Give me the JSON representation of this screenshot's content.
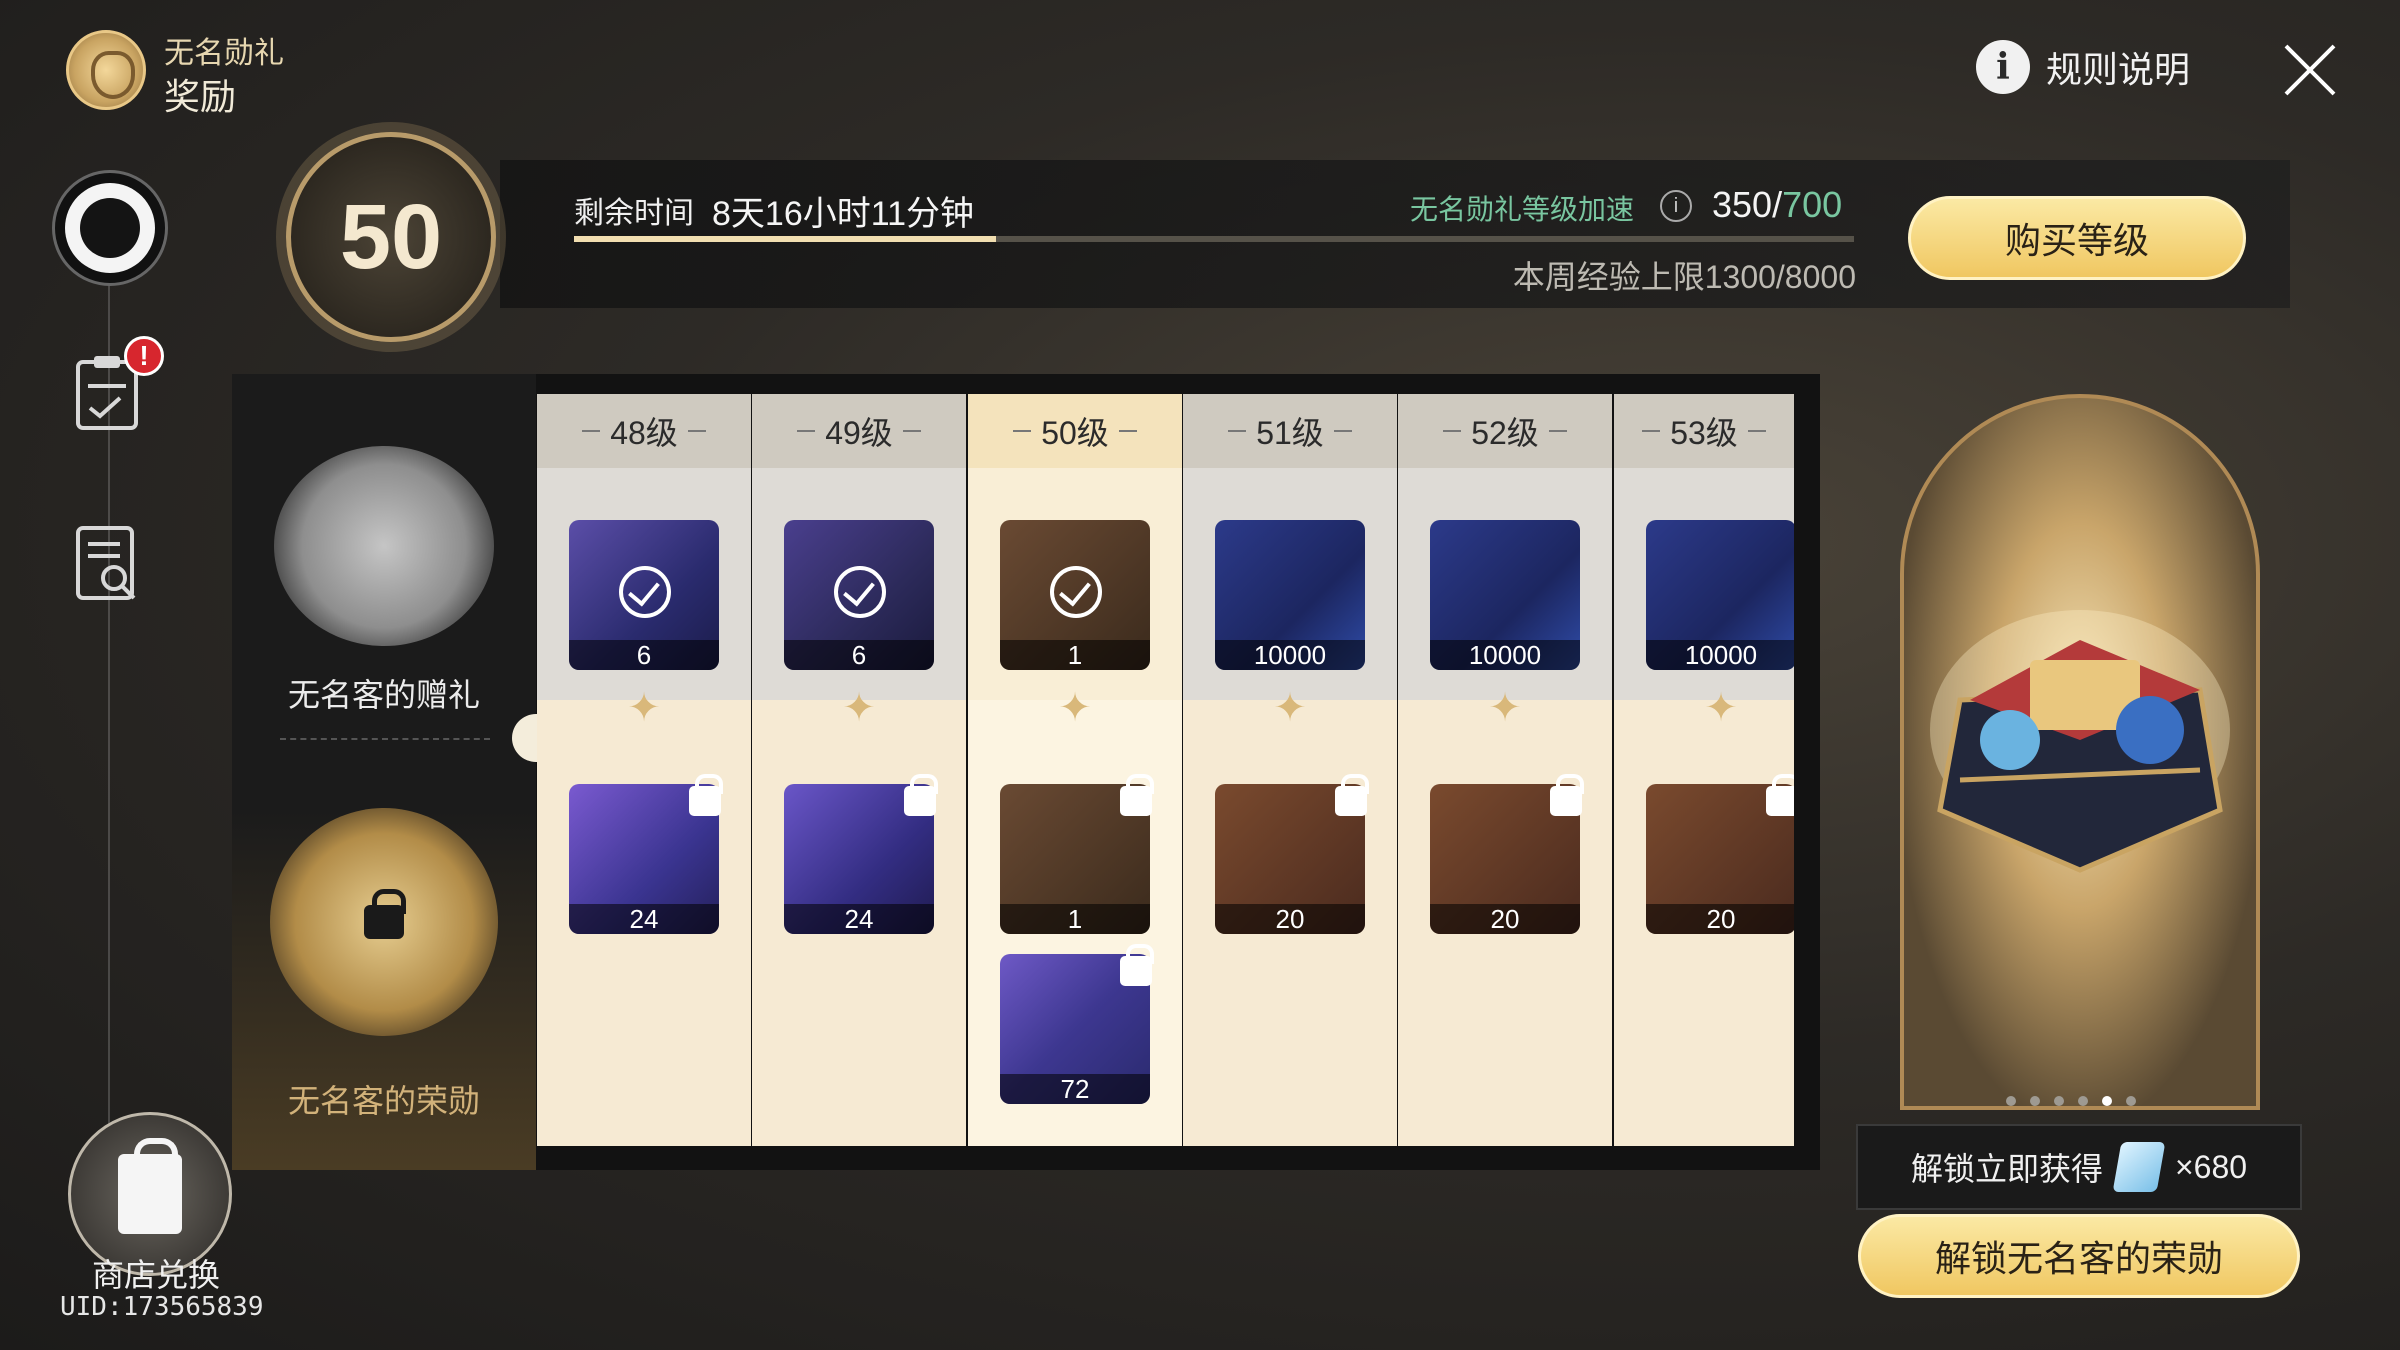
{
  "header": {
    "subtitle": "无名勋礼",
    "title": "奖励"
  },
  "rules": {
    "label": "规则说明",
    "icon": "info-icon"
  },
  "close": {
    "icon": "close-icon"
  },
  "sidebar": {
    "alert_count": "!",
    "shop_label": "商店兑换",
    "uid": "UID:173565839"
  },
  "level": {
    "current": "50"
  },
  "progress": {
    "time_label": "剩余时间",
    "time_value": "8天16小时11分钟",
    "fill_fraction": 0.33,
    "boost_label": "无名勋礼等级加速",
    "exp_current": "350/",
    "exp_max": "700",
    "week_cap": "本周经验上限1300/8000",
    "buy_button": "购买等级"
  },
  "tracks": {
    "free_label": "无名客的赠礼",
    "premium_label": "无名客的荣勋"
  },
  "levels": [
    {
      "label": "48级",
      "free": {
        "qty": "6",
        "claimed": true
      },
      "premium": [
        {
          "qty": "24"
        }
      ]
    },
    {
      "label": "49级",
      "free": {
        "qty": "6",
        "claimed": true
      },
      "premium": [
        {
          "qty": "24"
        }
      ]
    },
    {
      "label": "50级",
      "free": {
        "qty": "1",
        "claimed": true
      },
      "premium": [
        {
          "qty": "1"
        },
        {
          "qty": "72"
        }
      ]
    },
    {
      "label": "51级",
      "free": {
        "qty": "10000",
        "claimed": false
      },
      "premium": [
        {
          "qty": "20"
        }
      ]
    },
    {
      "label": "52级",
      "free": {
        "qty": "10000",
        "claimed": false
      },
      "premium": [
        {
          "qty": "20"
        }
      ]
    },
    {
      "label": "53级",
      "free": {
        "qty": "10000",
        "claimed": false
      },
      "premium": [
        {
          "qty": "20"
        }
      ]
    }
  ],
  "showcase": {
    "page_index": 4,
    "page_count": 6,
    "bonus_label": "解锁立即获得",
    "bonus_qty": "×680",
    "unlock_button": "解锁无名客的荣勋"
  },
  "colors": {
    "accent_gold": "#f0c761",
    "boost_green": "#79c6a0",
    "alert_red": "#d7262e"
  }
}
